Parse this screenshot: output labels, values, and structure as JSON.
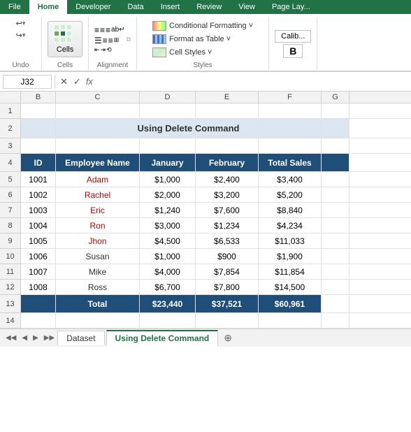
{
  "ribbon": {
    "tabs": [
      "File",
      "Home",
      "Developer",
      "Data",
      "Insert",
      "Review",
      "View",
      "Page Lay..."
    ],
    "active_tab": "Home",
    "groups": {
      "undo": {
        "label": "Undo",
        "undo_btn": "↩",
        "redo_btn": "↪"
      },
      "cells": {
        "label": "Cells",
        "btn_label": "Cells"
      },
      "alignment": {
        "label": "Alignment"
      },
      "styles": {
        "label": "Styles",
        "conditional": "Conditional Formatting ˅",
        "format_table": "Format as Table ˅",
        "cell_styles": "Cell Styles ˅"
      }
    },
    "font_group": {
      "label": "Calib...",
      "bold": "B"
    }
  },
  "formula_bar": {
    "cell_ref": "J32",
    "fx": "fx"
  },
  "spreadsheet": {
    "col_headers": [
      "",
      "B",
      "C",
      "D",
      "E",
      "F",
      "G"
    ],
    "row_numbers": [
      "1",
      "2",
      "3",
      "4",
      "5",
      "6",
      "7",
      "8",
      "9",
      "10",
      "11",
      "12",
      "13",
      "14"
    ],
    "title": "Using Delete Command",
    "table": {
      "headers": [
        "ID",
        "Employee Name",
        "January",
        "February",
        "Total Sales"
      ],
      "rows": [
        [
          "1001",
          "Adam",
          "$1,000",
          "$2,400",
          "$3,400"
        ],
        [
          "1002",
          "Rachel",
          "$2,000",
          "$3,200",
          "$5,200"
        ],
        [
          "1003",
          "Eric",
          "$1,240",
          "$7,600",
          "$8,840"
        ],
        [
          "1004",
          "Ron",
          "$3,000",
          "$1,234",
          "$4,234"
        ],
        [
          "1005",
          "Jhon",
          "$4,500",
          "$6,533",
          "$11,033"
        ],
        [
          "1006",
          "Susan",
          "$1,000",
          "$900",
          "$1,900"
        ],
        [
          "1007",
          "Mike",
          "$4,000",
          "$7,854",
          "$11,854"
        ],
        [
          "1008",
          "Ross",
          "$6,700",
          "$7,800",
          "$14,500"
        ]
      ],
      "total": [
        "Total",
        "",
        "$23,440",
        "$37,521",
        "$60,961"
      ]
    }
  },
  "sheet_tabs": {
    "tabs": [
      "Dataset",
      "Using Delete Command"
    ],
    "active": "Using Delete Command"
  }
}
